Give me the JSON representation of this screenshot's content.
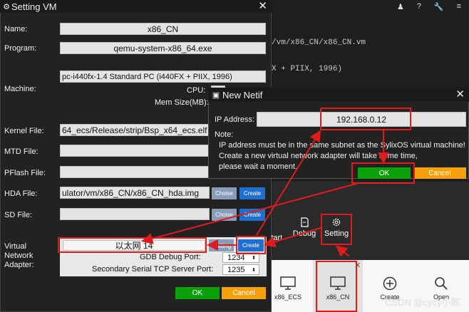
{
  "background_ide": {
    "code_lines": [
      "/vm/x86_CN/x86_CN.vm",
      "X + PIIX, 1996)"
    ],
    "toolbar_icons": [
      "user-icon",
      "help-icon",
      "wrench-icon",
      "menu-icon"
    ]
  },
  "setting_vm": {
    "title": "Setting VM",
    "labels": {
      "name": "Name:",
      "program": "Program:",
      "machine": "Machine:",
      "cpu": "CPU:",
      "mem": "Mem Size(MB):",
      "kernel": "Kernel File:",
      "mtd": "MTD File:",
      "pflash": "PFlash File:",
      "hda": "HDA File:",
      "sd": "SD File:",
      "virtual": "Virtual",
      "network": "Network",
      "adapter": "Adapter:",
      "gdb": "GDB Debug Port:",
      "serial": "Secondary Serial TCP Server Port:"
    },
    "values": {
      "name": "x86_CN",
      "program": "qemu-system-x86_64.exe",
      "machine": "pc-i440fx-1.4          Standard PC (i440FX + PIIX, 1996)",
      "kernel": "64_ecs/Release/strip/Bsp_x64_ecs.elf",
      "hda": "ulator/vm/x86_CN/x86_CN_hda.img",
      "adapter": "以太网 14",
      "gdb": "1234",
      "serial": "1235"
    },
    "buttons": {
      "choise": "Choise",
      "create": "Create",
      "setting": "Setting",
      "ok": "OK",
      "cancel": "Cancel"
    }
  },
  "new_netif": {
    "title": "New Netif",
    "ip_label": "IP Address:",
    "ip_value": "192.168.0.12",
    "note_label": "Note:",
    "note_lines": [
      "IP address must be in the same subnet as the SylixOS virtual machine!",
      "Create a new virtual network adapter will take some time,",
      "please wait a moment."
    ],
    "ok": "OK",
    "cancel": "Cancel"
  },
  "toolbar": {
    "start": "Start",
    "debug": "Debug",
    "setting": "Setting"
  },
  "tiles": [
    "x86_ECS",
    "x86_CN",
    "Create",
    "Open"
  ],
  "watermark": "CSDN @cycy小陈"
}
